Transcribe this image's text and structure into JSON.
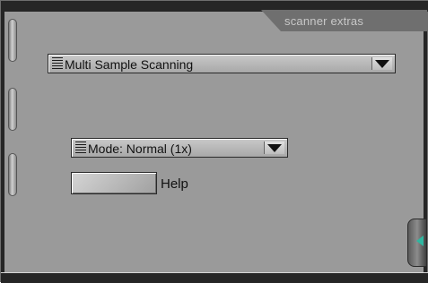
{
  "panel": {
    "tab_label": "scanner extras",
    "scan_dropdown": {
      "value": "Multi Sample Scanning"
    },
    "mode_dropdown": {
      "value": "Mode: Normal (1x)"
    },
    "help": {
      "label": "Help"
    }
  },
  "icons": {
    "dropdown_arrow": "chevron-down-icon",
    "expander_arrow": "triangle-left-icon"
  },
  "colors": {
    "panel_bg": "#9a9a9a",
    "frame": "#262626",
    "tab": "#6f6f6f",
    "accent": "#2fb6a0"
  }
}
